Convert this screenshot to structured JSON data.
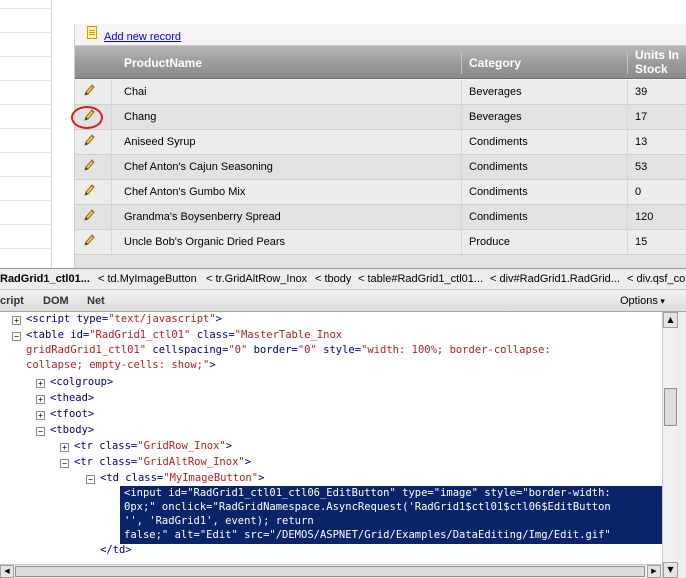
{
  "grid": {
    "add_new_record": "Add new record",
    "headers": {
      "product_name": "ProductName",
      "category": "Category",
      "units_in_stock": "Units In Stock"
    },
    "rows": [
      {
        "product_name": "Chai",
        "category": "Beverages",
        "units_in_stock": "39"
      },
      {
        "product_name": "Chang",
        "category": "Beverages",
        "units_in_stock": "17"
      },
      {
        "product_name": "Aniseed Syrup",
        "category": "Condiments",
        "units_in_stock": "13"
      },
      {
        "product_name": "Chef Anton's Cajun Seasoning",
        "category": "Condiments",
        "units_in_stock": "53"
      },
      {
        "product_name": "Chef Anton's Gumbo Mix",
        "category": "Condiments",
        "units_in_stock": "0"
      },
      {
        "product_name": "Grandma's Boysenberry Spread",
        "category": "Condiments",
        "units_in_stock": "120"
      },
      {
        "product_name": "Uncle Bob's Organic Dried Pears",
        "category": "Produce",
        "units_in_stock": "15"
      }
    ],
    "icons": {
      "edit": "pencil-icon",
      "add": "new-record-icon"
    },
    "highlight_color": "#d11f1f"
  },
  "firebug": {
    "breadcrumbs": [
      "RadGrid1_ctl01...",
      "< td.MyImageButton",
      "< tr.GridAltRow_Inox",
      "< tbody",
      "< table#RadGrid1_ctl01...",
      "< div#RadGrid1.RadGrid...",
      "< div.qsf_co"
    ],
    "tabs": {
      "script": "cript",
      "dom": "DOM",
      "net": "Net",
      "options": "Options"
    },
    "code": {
      "l1": {
        "open": "<",
        "tag": "script",
        "attr": " type=",
        "val": "\"text/javascript\"",
        "close": ">"
      },
      "l2": {
        "open": "<",
        "tag": "table",
        "a1": " id=",
        "v1": "\"RadGrid1_ctl01\"",
        "a2": " class=",
        "v2": "\"MasterTable_Inox"
      },
      "l3": {
        "v2b": "gridRadGrid1_ctl01\"",
        "a3": " cellspacing=",
        "v3": "\"0\"",
        "a4": " border=",
        "v4": "\"0\"",
        "a5": " style=",
        "v5": "\"width: 100%; border-collapse:"
      },
      "l4": {
        "v5b": "collapse; empty-cells: show;\"",
        "close": ">"
      },
      "colgroup": "<colgroup>",
      "thead": "<thead>",
      "tfoot": "<tfoot>",
      "tbody": "<tbody>",
      "tr1": {
        "open": "<",
        "tag": "tr",
        "attr": " class=",
        "val": "\"GridRow_Inox\"",
        "close": ">"
      },
      "tr2": {
        "open": "<",
        "tag": "tr",
        "attr": " class=",
        "val": "\"GridAltRow_Inox\"",
        "close": ">"
      },
      "td": {
        "open": "<",
        "tag": "td",
        "attr": " class=",
        "val": "\"MyImageButton\"",
        "close": ">"
      },
      "sel1": "<input id=\"RadGrid1_ctl01_ctl06_EditButton\" type=\"image\" style=\"border-width:",
      "sel2": "0px;\" onclick=\"RadGridNamespace.AsyncRequest('RadGrid1$ctl01$ctl06$EditButton",
      "sel3": "'', 'RadGrid1', event); return",
      "sel4": "false;\" alt=\"Edit\" src=\"/DEMOS/ASPNET/Grid/Examples/DataEditing/Img/Edit.gif\"",
      "td_close": "</td>"
    }
  },
  "colors": {
    "selection": "#0a246a",
    "tag": "#000080",
    "value": "#b22222",
    "grid_header": "#9a9a9a"
  }
}
